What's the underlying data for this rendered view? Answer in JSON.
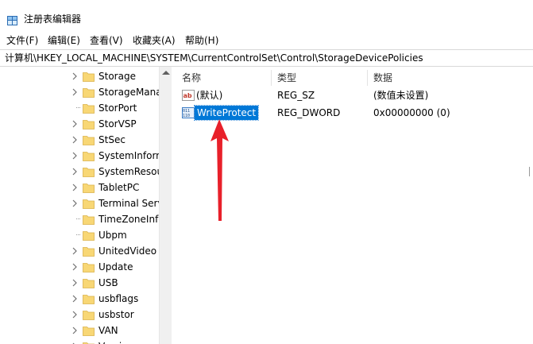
{
  "window": {
    "title": "注册表编辑器"
  },
  "menu": [
    {
      "label": "文件(F)"
    },
    {
      "label": "编辑(E)"
    },
    {
      "label": "查看(V)"
    },
    {
      "label": "收藏夹(A)"
    },
    {
      "label": "帮助(H)"
    }
  ],
  "address": {
    "path": "计算机\\HKEY_LOCAL_MACHINE\\SYSTEM\\CurrentControlSet\\Control\\StorageDevicePolicies"
  },
  "tree": {
    "items": [
      {
        "label": "Storage",
        "expandable": true
      },
      {
        "label": "StorageMana",
        "expandable": true
      },
      {
        "label": "StorPort",
        "expandable": false
      },
      {
        "label": "StorVSP",
        "expandable": true
      },
      {
        "label": "StSec",
        "expandable": true
      },
      {
        "label": "SystemInform",
        "expandable": true
      },
      {
        "label": "SystemResou",
        "expandable": true
      },
      {
        "label": "TabletPC",
        "expandable": true
      },
      {
        "label": "Terminal Serv",
        "expandable": true
      },
      {
        "label": "TimeZoneInfo",
        "expandable": false
      },
      {
        "label": "Ubpm",
        "expandable": false
      },
      {
        "label": "UnitedVideo",
        "expandable": true
      },
      {
        "label": "Update",
        "expandable": true
      },
      {
        "label": "USB",
        "expandable": true
      },
      {
        "label": "usbflags",
        "expandable": true
      },
      {
        "label": "usbstor",
        "expandable": true
      },
      {
        "label": "VAN",
        "expandable": true
      },
      {
        "label": "Version",
        "expandable": true
      }
    ]
  },
  "values": {
    "headers": {
      "name": "名称",
      "type": "类型",
      "data": "数据"
    },
    "rows": [
      {
        "name": "(默认)",
        "type": "REG_SZ",
        "data": "(数值未设置)",
        "icon": "string-value-icon",
        "selected": false
      },
      {
        "name": "WriteProtect",
        "type": "REG_DWORD",
        "data": "0x00000000 (0)",
        "icon": "dword-value-icon",
        "selected": true
      }
    ]
  },
  "colors": {
    "selection": "#0078d7",
    "folder": "#f8d775",
    "annotation_arrow": "#e8202a"
  }
}
